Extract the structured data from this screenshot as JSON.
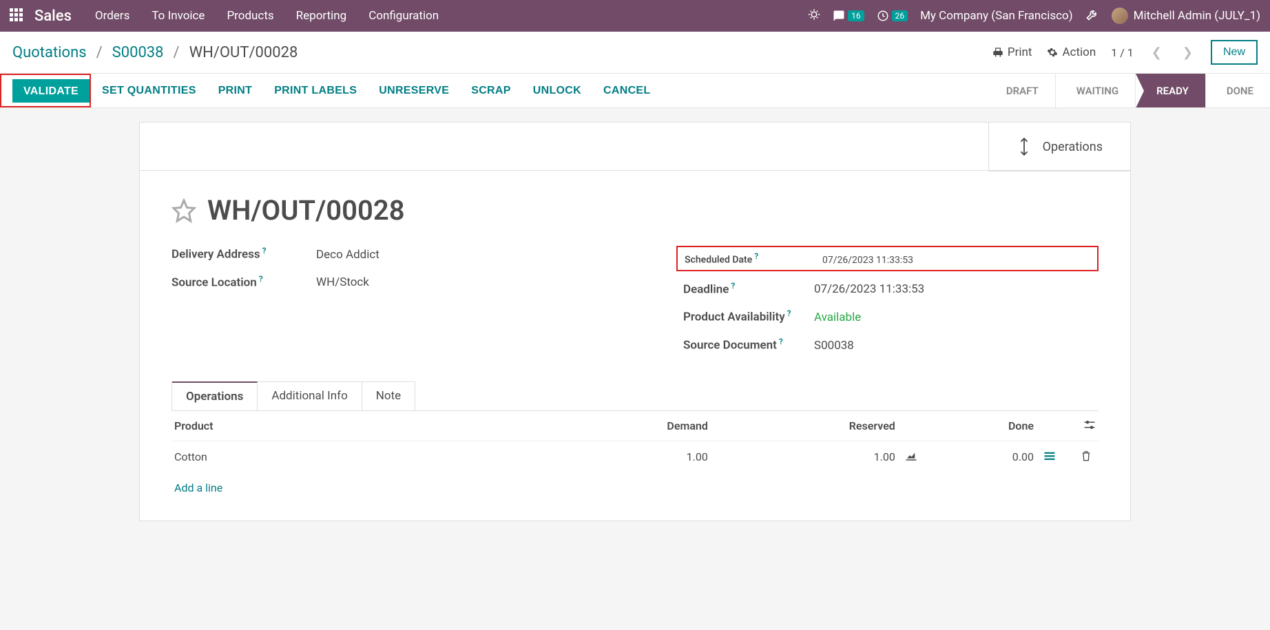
{
  "nav": {
    "brand": "Sales",
    "links": [
      "Orders",
      "To Invoice",
      "Products",
      "Reporting",
      "Configuration"
    ],
    "msg_count": "16",
    "act_count": "26",
    "company": "My Company (San Francisco)",
    "user": "Mitchell Admin (JULY_1)"
  },
  "breadcrumb": {
    "a": "Quotations",
    "b": "S00038",
    "c": "WH/OUT/00028",
    "print": "Print",
    "action": "Action",
    "pager": "1 / 1",
    "new": "New"
  },
  "actions": {
    "validate": "VALIDATE",
    "setq": "SET QUANTITIES",
    "print": "PRINT",
    "printlabels": "PRINT LABELS",
    "unreserve": "UNRESERVE",
    "scrap": "SCRAP",
    "unlock": "UNLOCK",
    "cancel": "CANCEL"
  },
  "stages": {
    "draft": "DRAFT",
    "waiting": "WAITING",
    "ready": "READY",
    "done": "DONE"
  },
  "sheet": {
    "ops_button": "Operations",
    "title": "WH/OUT/00028",
    "left": {
      "delivery_label": "Delivery Address",
      "delivery_val": "Deco Addict",
      "source_loc_label": "Source Location",
      "source_loc_val": "WH/Stock"
    },
    "right": {
      "sched_label": "Scheduled Date",
      "sched_val": "07/26/2023 11:33:53",
      "deadline_label": "Deadline",
      "deadline_val": "07/26/2023 11:33:53",
      "avail_label": "Product Availability",
      "avail_val": "Available",
      "srcdoc_label": "Source Document",
      "srcdoc_val": "S00038"
    },
    "tabs": {
      "ops": "Operations",
      "add": "Additional Info",
      "note": "Note"
    },
    "table": {
      "h_product": "Product",
      "h_demand": "Demand",
      "h_reserved": "Reserved",
      "h_done": "Done",
      "row": {
        "product": "Cotton",
        "demand": "1.00",
        "reserved": "1.00",
        "done": "0.00"
      },
      "addline": "Add a line"
    }
  }
}
